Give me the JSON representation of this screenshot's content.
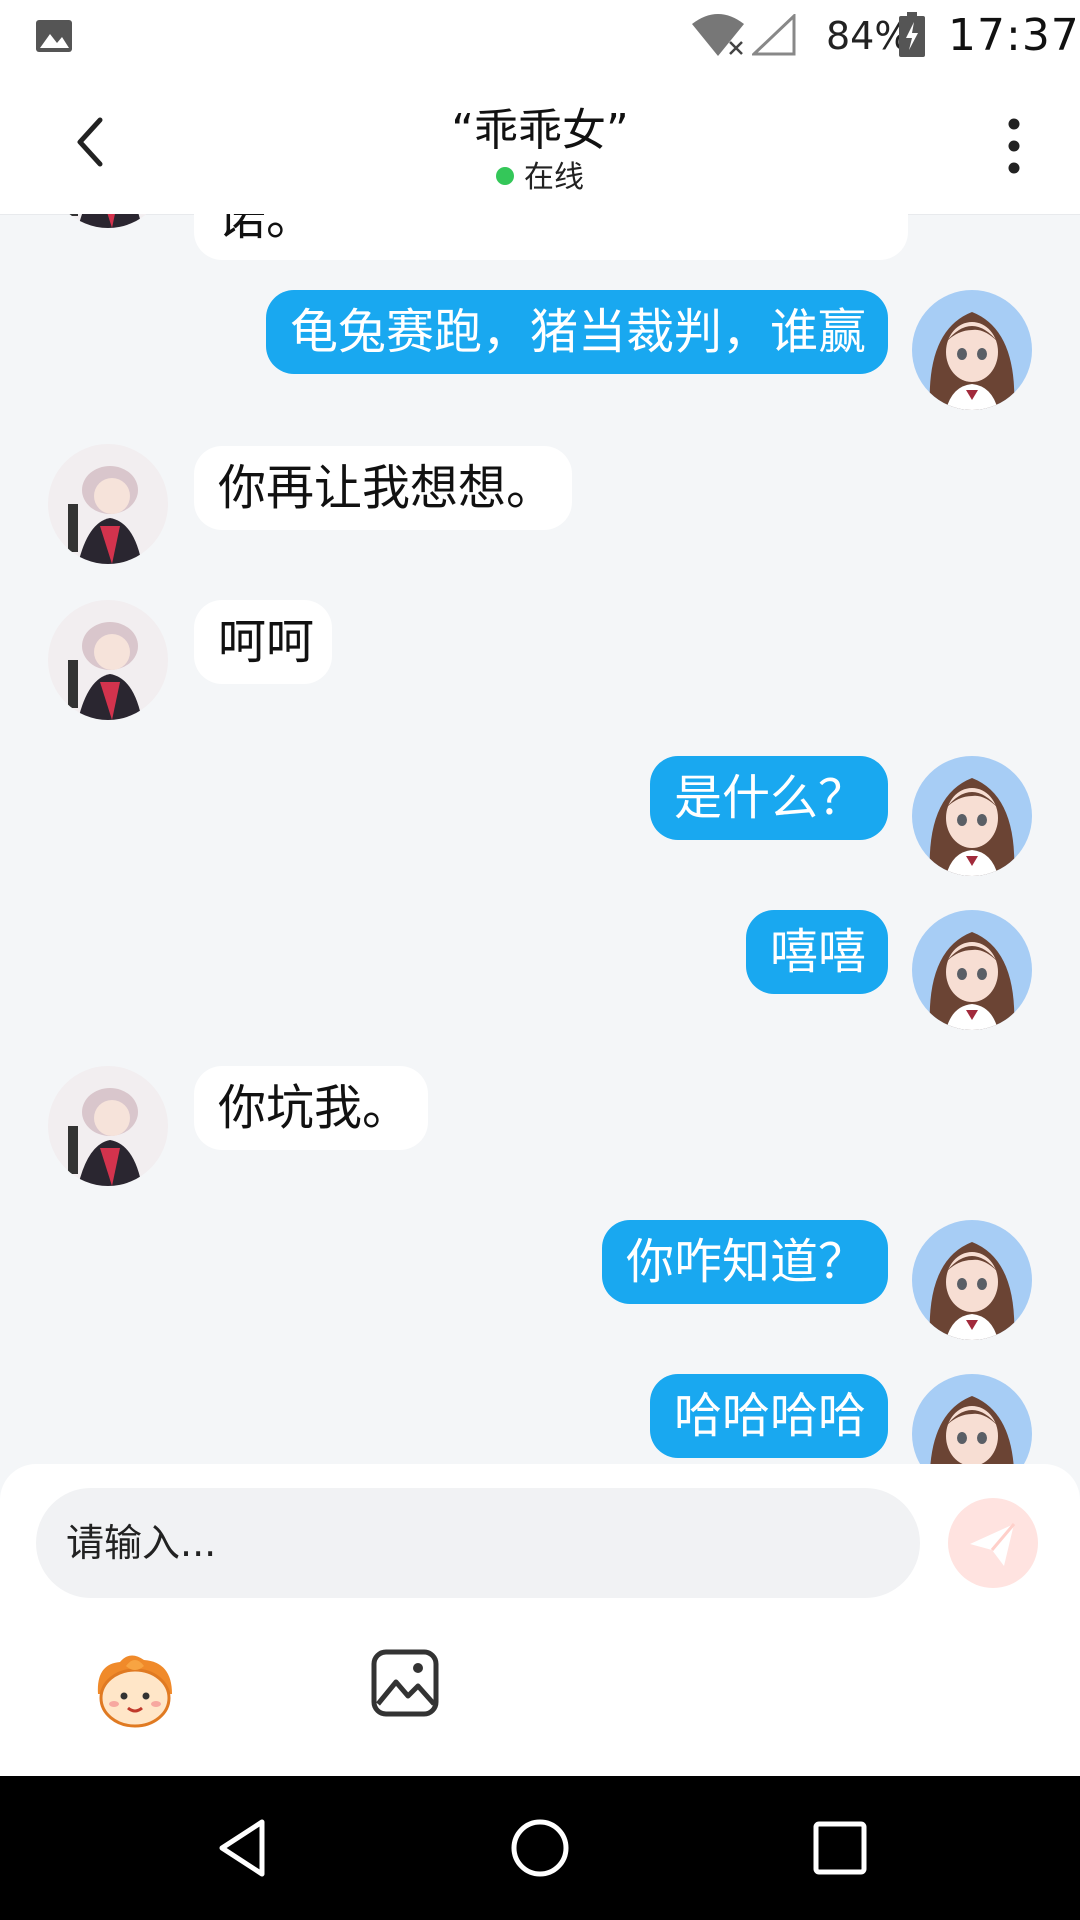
{
  "status_bar": {
    "battery_percent": "84%",
    "time": "17:37",
    "icons": [
      "gallery-icon",
      "wifi-icon",
      "signal-icon",
      "battery-charging-icon"
    ]
  },
  "header": {
    "title": "“乖乖女”",
    "presence": "在线",
    "icons": [
      "back-arrow-icon",
      "more-vert-icon"
    ]
  },
  "messages": [
    {
      "side": "in",
      "text": "诺。"
    },
    {
      "side": "out",
      "text": "龟兔赛跑，猪当裁判，谁赢"
    },
    {
      "side": "in",
      "text": "你再让我想想。"
    },
    {
      "side": "in",
      "text": "呵呵"
    },
    {
      "side": "out",
      "text": "是什么？"
    },
    {
      "side": "out",
      "text": "嘻嘻"
    },
    {
      "side": "in",
      "text": "你坑我。"
    },
    {
      "side": "out",
      "text": "你咋知道？"
    },
    {
      "side": "out",
      "text": "哈哈哈哈"
    }
  ],
  "composer": {
    "placeholder": "请输入...",
    "icons": [
      "send-icon",
      "emoji-face-icon",
      "image-icon"
    ]
  },
  "colors": {
    "outgoing_bubble": "#19a8f0",
    "incoming_bubble": "#ffffff",
    "chat_background": "#f4f6f8",
    "presence_online": "#34c759",
    "send_button": "#ffe3e0"
  }
}
